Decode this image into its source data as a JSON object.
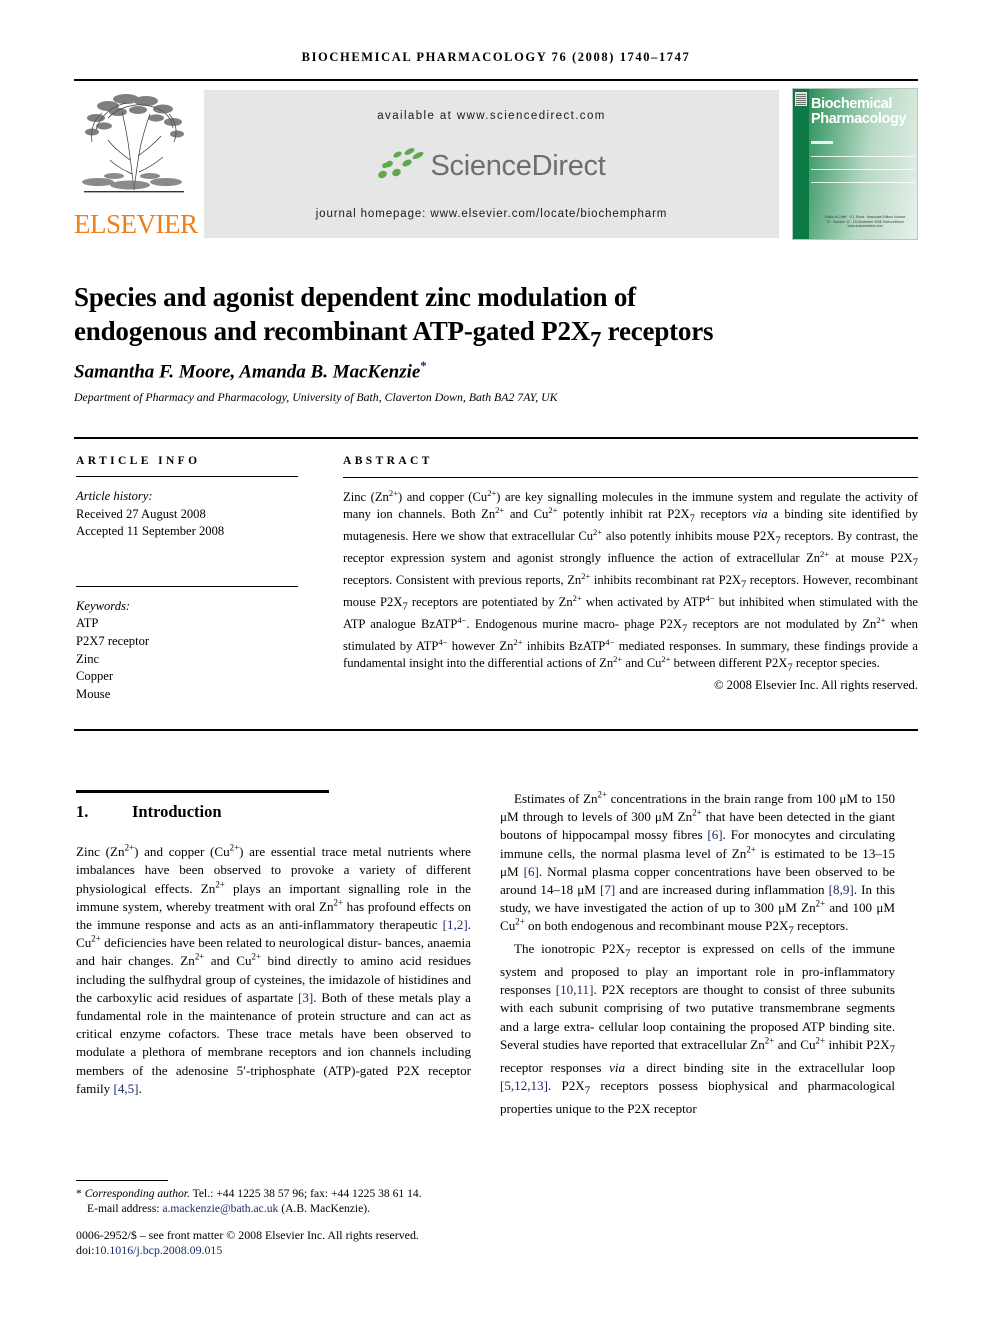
{
  "running_head": "BIOCHEMICAL PHARMACOLOGY 76 (2008) 1740–1747",
  "masthead": {
    "publisher": "ELSEVIER",
    "available_at": "available at www.sciencedirect.com",
    "sciencedirect_wordmark": "ScienceDirect",
    "journal_homepage": "journal homepage: www.elsevier.com/locate/biochempharm",
    "cover_title_line1": "Biochemical",
    "cover_title_line2": "Pharmacology",
    "cover_footer": "Editor-in-Chief ·  S.J. Enna   ·   Associate Editors\nVolume 76 · Number 12 · 15 December 2008\nScienceDirect\nwww.sciencedirect.com"
  },
  "article": {
    "title_line1": "Species and agonist dependent zinc modulation of",
    "title_line2_a": "endogenous and recombinant ATP-gated P2X",
    "title_line2_sub": "7",
    "title_line2_b": " receptors",
    "authors": "Samantha F. Moore, Amanda B. MacKenzie",
    "author_star": "*",
    "affiliation": "Department of Pharmacy and Pharmacology, University of Bath, Claverton Down, Bath BA2 7AY, UK"
  },
  "article_info": {
    "heading": "ARTICLE INFO",
    "history_label": "Article history:",
    "received": "Received 27 August 2008",
    "accepted": "Accepted 11 September 2008",
    "keywords_label": "Keywords:",
    "keywords": [
      "ATP",
      "P2X7 receptor",
      "Zinc",
      "Copper",
      "Mouse"
    ]
  },
  "abstract": {
    "heading": "ABSTRACT",
    "text": "Zinc (Zn2+) and copper (Cu2+) are key signalling molecules in the immune system and regulate the activity of many ion channels. Both Zn2+ and Cu2+ potently inhibit rat P2X7 receptors via a binding site identified by mutagenesis. Here we show that extracellular Cu2+ also potently inhibits mouse P2X7 receptors. By contrast, the receptor expression system and agonist strongly influence the action of extracellular Zn2+ at mouse P2X7 receptors. Consistent with previous reports, Zn2+ inhibits recombinant rat P2X7 receptors. However, recombinant mouse P2X7 receptors are potentiated by Zn2+ when activated by ATP4− but inhibited when stimulated with the ATP analogue BzATP4−. Endogenous murine macrophage P2X7 receptors are not modulated by Zn2+ when stimulated by ATP4− however Zn2+ inhibits BzATP4− mediated responses. In summary, these findings provide a fundamental insight into the differential actions of Zn2+ and Cu2+ between different P2X7 receptor species.",
    "copyright": "© 2008 Elsevier Inc. All rights reserved."
  },
  "introduction": {
    "number": "1.",
    "title": "Introduction",
    "paragraph1": "Zinc (Zn2+) and copper (Cu2+) are essential trace metal nutrients where imbalances have been observed to provoke a variety of different physiological effects. Zn2+ plays an important signalling role in the immune system, whereby treatment with oral Zn2+ has profound effects on the immune response and acts as an anti-inflammatory therapeutic [1,2]. Cu2+ deficiencies have been related to neurological disturbances, anaemia and hair changes. Zn2+ and Cu2+ bind directly to amino acid residues including the sulfhydral group of cysteines, the imidazole of histidines and the carboxylic acid residues of aspartate [3]. Both of these metals play a fundamental role in the maintenance of protein structure and can act as critical enzyme cofactors. These trace metals have been observed to modulate a plethora of membrane receptors and ion channels including members of the adenosine 5′-triphosphate (ATP)-gated P2X receptor family [4,5].",
    "paragraph2": "Estimates of Zn2+ concentrations in the brain range from 100 μM to 150 μM through to levels of 300 μM Zn2+ that have been detected in the giant boutons of hippocampal mossy fibres [6]. For monocytes and circulating immune cells, the normal plasma level of Zn2+ is estimated to be 13–15 μM [6]. Normal plasma copper concentrations have been observed to be around 14–18 μM [7] and are increased during inflammation [8,9]. In this study, we have investigated the action of up to 300 μM Zn2+ and 100 μM Cu2+ on both endogenous and recombinant mouse P2X7 receptors.",
    "paragraph3": "The ionotropic P2X7 receptor is expressed on cells of the immune system and proposed to play an important role in pro-inflammatory responses [10,11]. P2X receptors are thought to consist of three subunits with each subunit comprising of two putative transmembrane segments and a large extracellular loop containing the proposed ATP binding site. Several studies have reported that extracellular Zn2+ and Cu2+ inhibit P2X7 receptor responses via a direct binding site in the extracellular loop [5,12,13]. P2X7 receptors possess biophysical and pharmacological properties unique to the P2X receptor"
  },
  "footnote": {
    "corresponding_label": "Corresponding author.",
    "contact": " Tel.: +44 1225 38 57 96; fax: +44 1225 38 61 14.",
    "email_label": "E-mail address:",
    "email": "a.mackenzie@bath.ac.uk",
    "email_owner": "(A.B. MacKenzie).",
    "issn_line": "0006-2952/$ – see front matter © 2008 Elsevier Inc. All rights reserved.",
    "doi_label": "doi:",
    "doi": "10.1016/j.bcp.2008.09.015"
  },
  "colors": {
    "elsevier_orange": "#EE7F1A",
    "sciencedirect_green": "#5FA84E",
    "sciencedirect_gray": "#6d6e70",
    "link_blue": "#1b2a6b",
    "cover_green": "#0d7a45",
    "band_gray": "#e6e6e6"
  }
}
